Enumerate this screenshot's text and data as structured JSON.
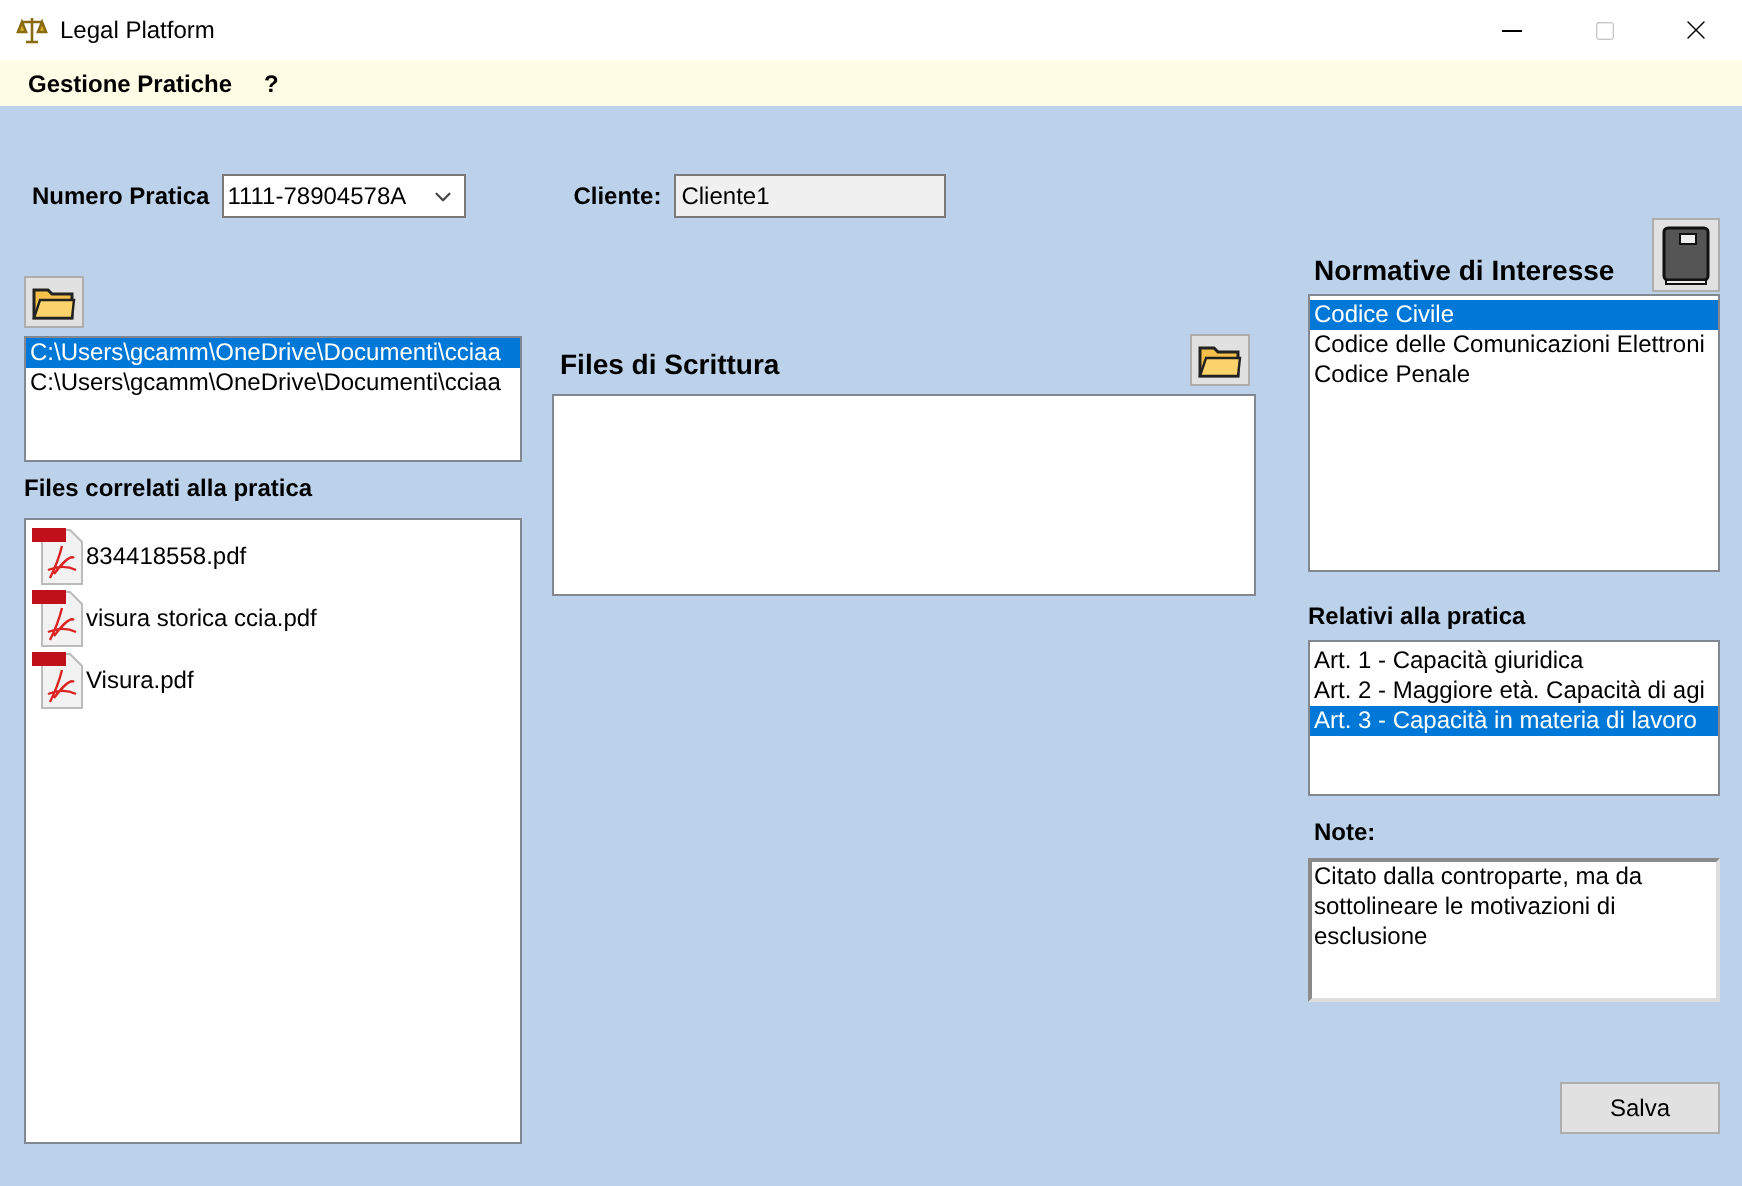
{
  "window": {
    "title": "Legal Platform"
  },
  "menu": [
    "Gestione Pratiche",
    "?"
  ],
  "numero_pratica": {
    "label": "Numero Pratica",
    "value": "1111-78904578A"
  },
  "cliente": {
    "label": "Cliente:",
    "value": "Cliente1"
  },
  "paths": [
    {
      "text": "C:\\Users\\gcamm\\OneDrive\\Documenti\\cciaa",
      "selected": true
    },
    {
      "text": "C:\\Users\\gcamm\\OneDrive\\Documenti\\cciaa",
      "selected": false
    }
  ],
  "files_label": "Files correlati alla pratica",
  "files": [
    "834418558.pdf",
    "visura storica ccia.pdf",
    "Visura.pdf"
  ],
  "scrittura_label": "Files di Scrittura",
  "normative": {
    "title": "Normative di Interesse",
    "items": [
      {
        "text": "Codice Civile",
        "selected": true
      },
      {
        "text": "Codice delle Comunicazioni Elettroni",
        "selected": false
      },
      {
        "text": "Codice Penale",
        "selected": false
      }
    ]
  },
  "relativi": {
    "label": "Relativi alla pratica",
    "items": [
      {
        "text": "Art. 1 - Capacità giuridica",
        "selected": false
      },
      {
        "text": "Art. 2 - Maggiore età. Capacità di agi",
        "selected": false
      },
      {
        "text": "Art. 3 - Capacità in materia di lavoro",
        "selected": true
      }
    ]
  },
  "note": {
    "label": "Note:",
    "value": "Citato dalla controparte, ma da sottolineare le motivazioni di esclusione"
  },
  "save_button": "Salva"
}
